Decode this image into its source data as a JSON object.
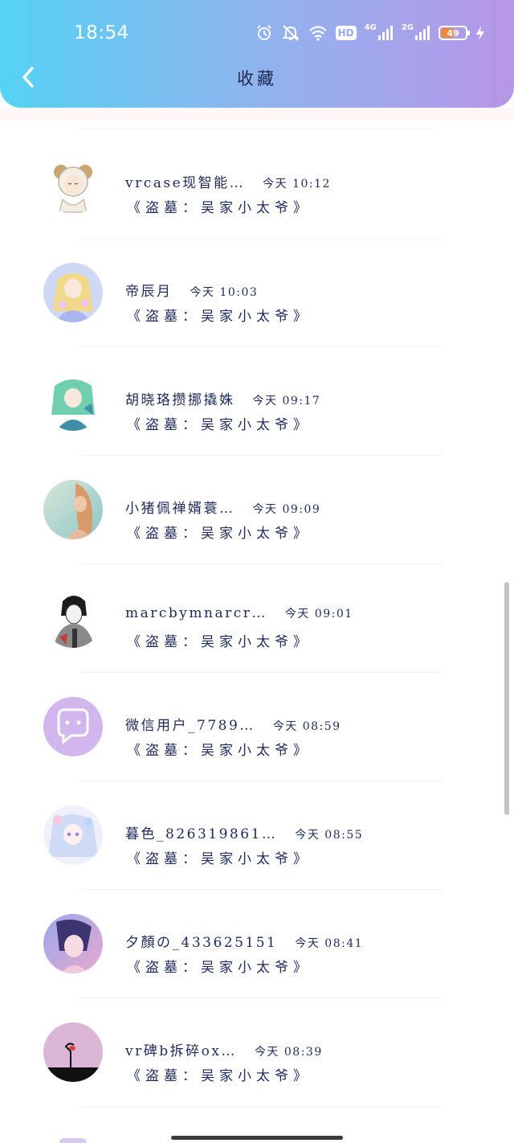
{
  "status_bar": {
    "time": "18:54",
    "hd_label": "HD",
    "net_4g": "4G",
    "net_2g": "2G",
    "battery_level": "49",
    "battery_fraction": 0.49
  },
  "header": {
    "title": "收藏"
  },
  "favorites": [
    {
      "name": "vrcase现智能…",
      "time": "今天 10:12",
      "quote": "《盗墓：吴家小太爷》"
    },
    {
      "name": "帝辰月",
      "time": "今天 10:03",
      "quote": "《盗墓：吴家小太爷》"
    },
    {
      "name": "胡晓珞攒挪撬姝",
      "time": "今天 09:17",
      "quote": "《盗墓：吴家小太爷》"
    },
    {
      "name": "小猪佩禅婿蓑…",
      "time": "今天 09:09",
      "quote": "《盗墓：吴家小太爷》"
    },
    {
      "name": "marcbymnarcr…",
      "time": "今天 09:01",
      "quote": "《盗墓：吴家小太爷》"
    },
    {
      "name": "微信用户_7789…",
      "time": "今天 08:59",
      "quote": "《盗墓：吴家小太爷》"
    },
    {
      "name": "暮色_826319861…",
      "time": "今天 08:55",
      "quote": "《盗墓：吴家小太爷》"
    },
    {
      "name": "夕顏の_433625151",
      "time": "今天 08:41",
      "quote": "《盗墓：吴家小太爷》"
    },
    {
      "name": "vr碑b拆碎ox…",
      "time": "今天 08:39",
      "quote": "《盗墓：吴家小太爷》"
    }
  ],
  "colors": {
    "header_gradient_start": "#55d2f4",
    "header_gradient_end": "#b796e8",
    "text": "#1d2a5a",
    "battery": "#f08a3a"
  },
  "icons": [
    "chevron-left-icon",
    "alarm-icon",
    "mute-icon",
    "wifi-icon",
    "signal-icon",
    "battery-icon",
    "charging-icon"
  ]
}
